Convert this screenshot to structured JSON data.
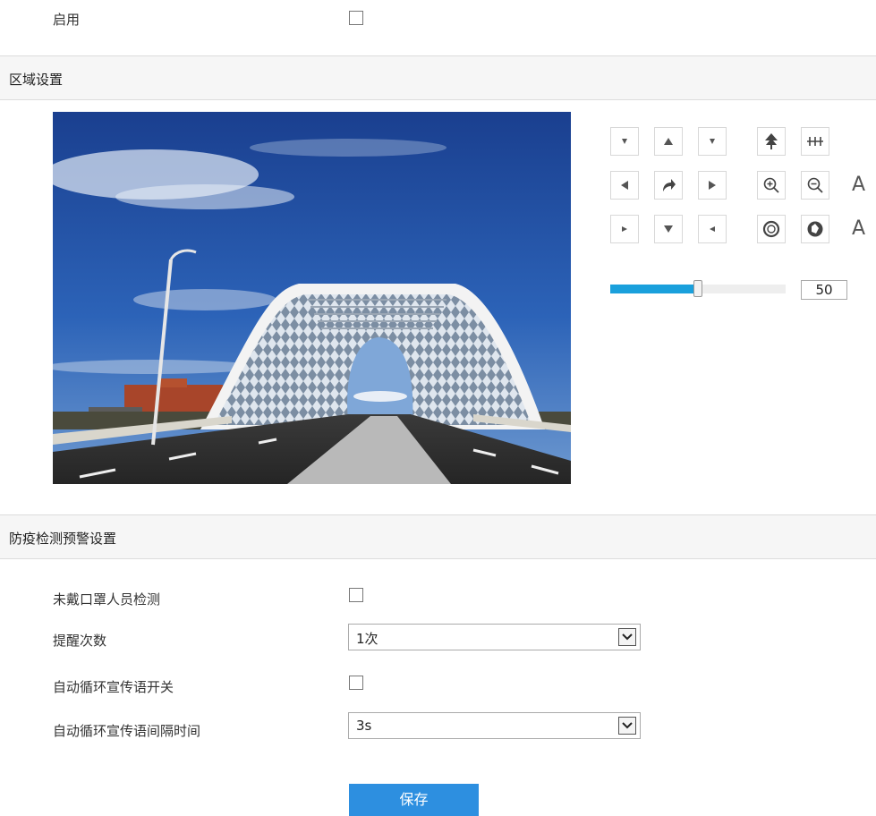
{
  "enable": {
    "label": "启用",
    "checked": false
  },
  "region": {
    "title": "区域设置"
  },
  "ptz": {
    "focus_near_label": "A",
    "iris_label": "A",
    "speed_value": 50,
    "speed_max": 100
  },
  "detection": {
    "title": "防疫检测预警设置",
    "mask_detect_label": "未戴口罩人员检测",
    "reminder_count_label": "提醒次数",
    "reminder_count_value": "1次",
    "auto_loop_label": "自动循环宣传语开关",
    "auto_loop_interval_label": "自动循环宣传语间隔时间",
    "auto_loop_interval_value": "3s"
  },
  "save_label": "保存"
}
